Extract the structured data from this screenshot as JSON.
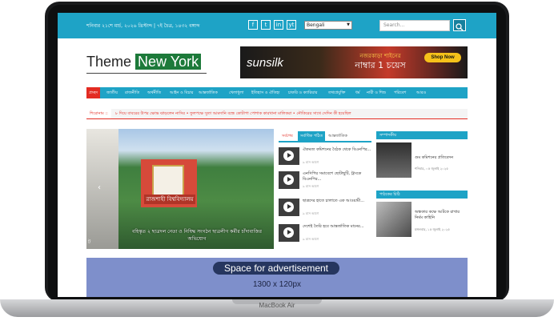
{
  "device_label": "MacBook Air",
  "topbar": {
    "date": "শনিবার ২১শে মার্চ, ২০২৬ খ্রিস্টাব্দ | ৭ই চৈত্র, ১৪৩২ বঙ্গাব্দ",
    "language": "Bengali",
    "search_placeholder": "Search...",
    "social": [
      "f",
      "t",
      "in",
      "yt"
    ]
  },
  "logo": {
    "part1": "Theme ",
    "part2": "New York"
  },
  "banner": {
    "brand": "sunsilk",
    "text": "নজরকাড়া শাইনের",
    "text2": "নাম্বার 1 চয়েস",
    "cta": "Shop Now"
  },
  "nav": [
    "প্রচ্ছদ",
    "জাতীয়",
    "রাজনীতি",
    "অর্থনীতি",
    "আইন ও বিচার",
    "আন্তর্জাতিক",
    "খেলাধুলা",
    "ইতিহাস ও ঐতিহ্য",
    "চাকরি ও ক্যারিয়ার",
    "তথ্যপ্রযুক্তি",
    "ধর্ম",
    "নারী ও শিশু",
    "পরিবেশ",
    "আরও"
  ],
  "ticker": {
    "label": "শিরোনাম ::",
    "text": "৮ দিয়ে বাবরের উপর ক্ষোভ ঝাড়লেন নাসির   •  ফুলপক্ষে সুতা আমদানি বন্ধে কোটাপা পোশাক কারখানা মালিকরা   •  নৌকিরের সাথে সেদিন কী হয়েছিল"
  },
  "slider": {
    "caption": "বহিস্কৃত ২ ছাত্রদল নেতা ও নিষিদ্ধ সংগঠন ছাত্রলীগ কর্মীর চাঁদাবাজির অভিযোগ",
    "sign": "রাজশাহী বিশ্ববিদ্যালয়",
    "side_tag": "ট"
  },
  "tabs": [
    "সর্বশেষ",
    "সর্বাধিক পঠিত",
    "আন্তর্জাতিক"
  ],
  "videos": [
    {
      "title": "ঐকমত্য কমিশনের বৈঠক থেকে বিএনপির...",
      "time": "৯ মাস আগে"
    },
    {
      "title": "এনসিপির সমাবেশে ছোটাছুটি, ট্রাংকে বিএনপির...",
      "time": "৯ মাস আগে"
    },
    {
      "title": "ছাত্রদের হাতে চালাতে এক আওয়ামী...",
      "time": "৯ মাস আগে"
    },
    {
      "title": "দেশেই তৈরি হবে আন্তর্জাতিক মানের...",
      "time": "৯ মাস আগে"
    }
  ],
  "right": {
    "section1": "সম্পাদকীয়",
    "s1_title": "গুম কমিশনের প্রতিবেদন",
    "s1_date": "শনিবার, ০৫ জুলাই ২০২৫",
    "section2": "পাঠকের চিঠি",
    "s2_title": "অন্ধকার কক্ষে আটকে রাখার নির্মম কাহিনি",
    "s2_date": "মঙ্গলবার, ১৫ জুলাই ২০২৫"
  },
  "ad": {
    "label": "Space for advertisement",
    "size": "1300 x 120px"
  }
}
